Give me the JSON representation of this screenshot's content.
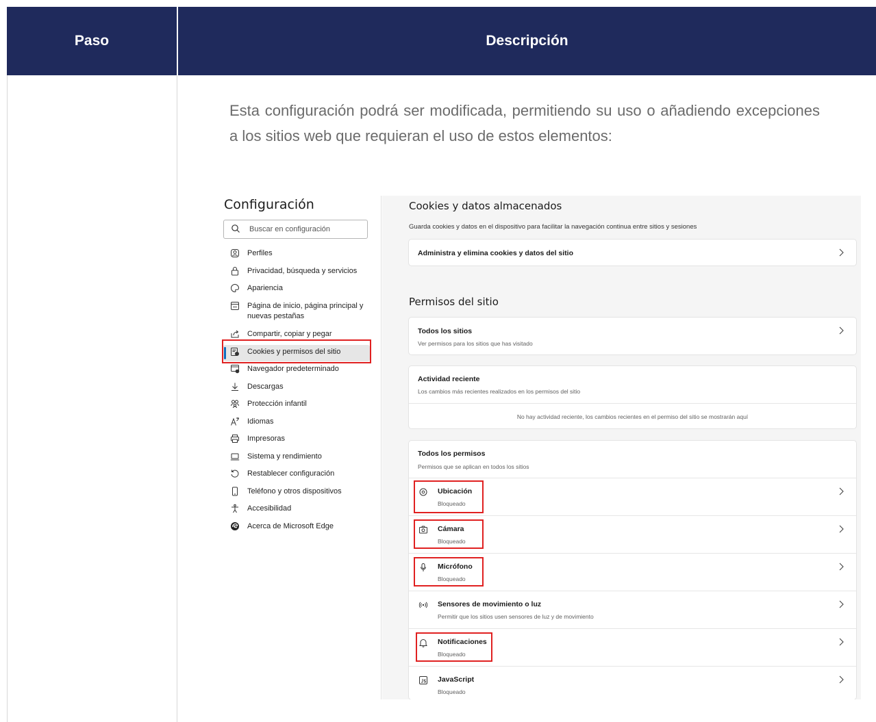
{
  "table": {
    "header_step": "Paso",
    "header_description": "Descripción"
  },
  "description": "Esta configuración podrá ser modificada, permitiendo su uso o añadiendo excepciones a los sitios web que requieran el uso de estos elementos:",
  "settings": {
    "title": "Configuración",
    "search_placeholder": "Buscar en configuración",
    "nav": [
      {
        "label": "Perfiles",
        "icon": "profile-icon"
      },
      {
        "label": "Privacidad, búsqueda y servicios",
        "icon": "lock-icon"
      },
      {
        "label": "Apariencia",
        "icon": "palette-icon"
      },
      {
        "label": "Página de inicio, página principal y nuevas pestañas",
        "icon": "home-tab-icon"
      },
      {
        "label": "Compartir, copiar y pegar",
        "icon": "share-icon"
      },
      {
        "label": "Cookies y permisos del sitio",
        "icon": "cookies-icon",
        "active": true
      },
      {
        "label": "Navegador predeterminado",
        "icon": "browser-icon"
      },
      {
        "label": "Descargas",
        "icon": "download-icon"
      },
      {
        "label": "Protección infantil",
        "icon": "family-icon"
      },
      {
        "label": "Idiomas",
        "icon": "language-icon"
      },
      {
        "label": "Impresoras",
        "icon": "printer-icon"
      },
      {
        "label": "Sistema y rendimiento",
        "icon": "laptop-icon"
      },
      {
        "label": "Restablecer configuración",
        "icon": "reset-icon"
      },
      {
        "label": "Teléfono y otros dispositivos",
        "icon": "phone-icon"
      },
      {
        "label": "Accesibilidad",
        "icon": "accessibility-icon"
      },
      {
        "label": "Acerca de Microsoft Edge",
        "icon": "edge-logo-icon"
      }
    ],
    "cookies": {
      "heading": "Cookies y datos almacenados",
      "subtitle": "Guarda cookies y datos en el dispositivo para facilitar la navegación continua entre sitios y sesiones",
      "manage_label": "Administra y elimina cookies y datos del sitio"
    },
    "permissions": {
      "heading": "Permisos del sitio",
      "all_sites_title": "Todos los sitios",
      "all_sites_desc": "Ver permisos para los sitios que has visitado",
      "recent_title": "Actividad reciente",
      "recent_desc": "Los cambios más recientes realizados en los permisos del sitio",
      "recent_empty": "No hay actividad reciente, los cambios recientes en el permiso del sitio se mostrarán aquí",
      "all_perms_title": "Todos los permisos",
      "all_perms_desc": "Permisos que se aplican en todos los sitios",
      "items": [
        {
          "title": "Ubicación",
          "status": "Bloqueado",
          "icon": "location-icon"
        },
        {
          "title": "Cámara",
          "status": "Bloqueado",
          "icon": "camera-icon"
        },
        {
          "title": "Micrófono",
          "status": "Bloqueado",
          "icon": "microphone-icon"
        },
        {
          "title": "Sensores de movimiento o luz",
          "status": "Permitir que los sitios usen sensores de luz y de movimiento",
          "icon": "sensor-icon"
        },
        {
          "title": "Notificaciones",
          "status": "Bloqueado",
          "icon": "bell-icon"
        },
        {
          "title": "JavaScript",
          "status": "Bloqueado",
          "icon": "javascript-icon"
        }
      ]
    }
  },
  "colors": {
    "header_bg": "#1f2a5c",
    "highlight": "#e02020",
    "accent": "#0f6cbd"
  }
}
